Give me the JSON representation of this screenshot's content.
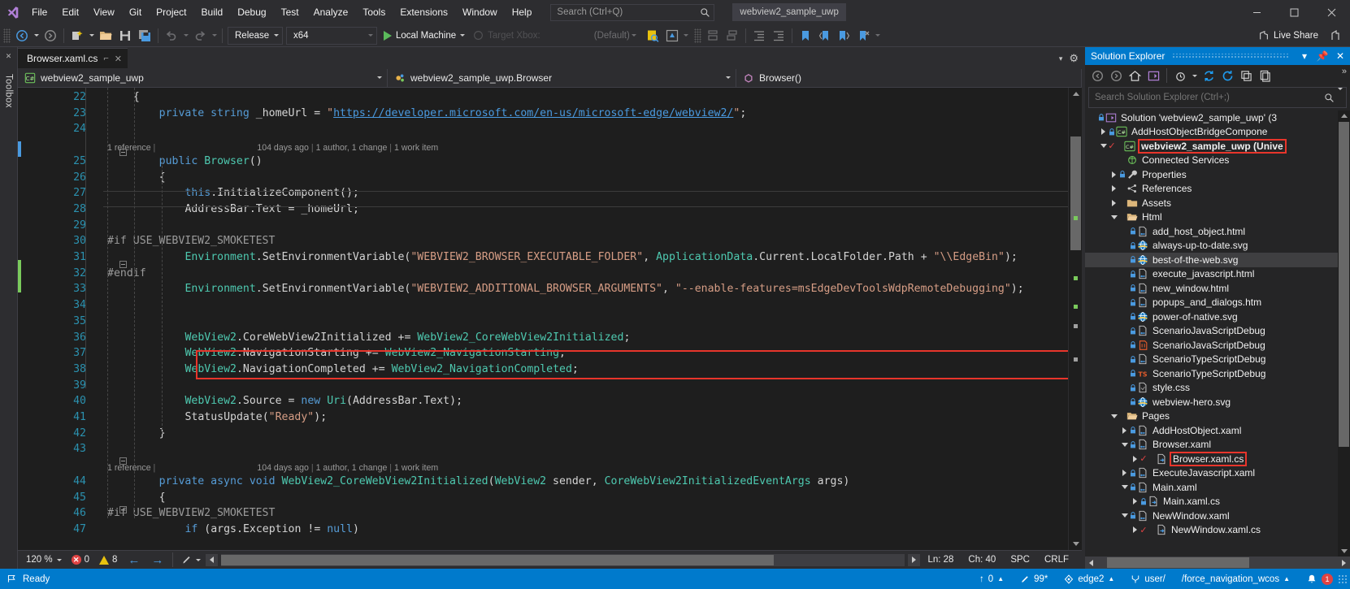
{
  "menubar": {
    "logo": "visual-studio-logo",
    "items": [
      "File",
      "Edit",
      "View",
      "Git",
      "Project",
      "Build",
      "Debug",
      "Test",
      "Analyze",
      "Tools",
      "Extensions",
      "Window",
      "Help"
    ],
    "search_placeholder": "Search (Ctrl+Q)",
    "solution_chip": "webview2_sample_uwp",
    "window_controls": [
      "minimize",
      "maximize",
      "close"
    ]
  },
  "toolbar": {
    "configuration": "Release",
    "platform": "x64",
    "run_target": "Local Machine",
    "target_xbox": "Target Xbox:",
    "default_label": "(Default)",
    "live_share": "Live Share"
  },
  "toolbox": {
    "label": "Toolbox"
  },
  "editor": {
    "tab_title": "Browser.xaml.cs",
    "nav_project": "webview2_sample_uwp",
    "nav_class": "webview2_sample_uwp.Browser",
    "nav_member": "Browser()",
    "zoom": "120 %",
    "errors": "0",
    "warnings": "8",
    "line_pos": "Ln: 28",
    "char_pos": "Ch: 40",
    "indent_mode": "SPC",
    "line_ending": "CRLF",
    "codelens": {
      "references": "1 reference",
      "age": "104 days ago",
      "authors": "1 author, 1 change",
      "work_items": "1 work item"
    },
    "lines": [
      {
        "num": "22",
        "text": "    {"
      },
      {
        "num": "23",
        "text": "        private string _homeUrl = \"https://developer.microsoft.com/en-us/microsoft-edge/webview2/\";"
      },
      {
        "num": "24",
        "text": ""
      },
      {
        "num": "",
        "text": "CODELENS_1"
      },
      {
        "num": "25",
        "text": "        public Browser()"
      },
      {
        "num": "26",
        "text": "        {"
      },
      {
        "num": "27",
        "text": "            this.InitializeComponent();"
      },
      {
        "num": "28",
        "text": "            AddressBar.Text = _homeUrl;"
      },
      {
        "num": "29",
        "text": ""
      },
      {
        "num": "30",
        "text": "#if USE_WEBVIEW2_SMOKETEST"
      },
      {
        "num": "31",
        "text": "            Environment.SetEnvironmentVariable(\"WEBVIEW2_BROWSER_EXECUTABLE_FOLDER\", ApplicationData.Current.LocalFolder.Path + \"\\\\EdgeBin\");"
      },
      {
        "num": "32",
        "text": "#endif"
      },
      {
        "num": "33",
        "text": "            Environment.SetEnvironmentVariable(\"WEBVIEW2_ADDITIONAL_BROWSER_ARGUMENTS\", \"--enable-features=msEdgeDevToolsWdpRemoteDebugging\");"
      },
      {
        "num": "34",
        "text": ""
      },
      {
        "num": "35",
        "text": ""
      },
      {
        "num": "36",
        "text": "            WebView2.CoreWebView2Initialized += WebView2_CoreWebView2Initialized;"
      },
      {
        "num": "37",
        "text": "            WebView2.NavigationStarting += WebView2_NavigationStarting;"
      },
      {
        "num": "38",
        "text": "            WebView2.NavigationCompleted += WebView2_NavigationCompleted;"
      },
      {
        "num": "39",
        "text": ""
      },
      {
        "num": "40",
        "text": "            WebView2.Source = new Uri(AddressBar.Text);"
      },
      {
        "num": "41",
        "text": "            StatusUpdate(\"Ready\");"
      },
      {
        "num": "42",
        "text": "        }"
      },
      {
        "num": "43",
        "text": ""
      },
      {
        "num": "",
        "text": "CODELENS_2"
      },
      {
        "num": "44",
        "text": "        private async void WebView2_CoreWebView2Initialized(WebView2 sender, CoreWebView2InitializedEventArgs args)"
      },
      {
        "num": "45",
        "text": "        {"
      },
      {
        "num": "46",
        "text": "#if USE_WEBVIEW2_SMOKETEST"
      },
      {
        "num": "47",
        "text": "            if (args.Exception != null)"
      }
    ]
  },
  "solution_explorer": {
    "title": "Solution Explorer",
    "search_placeholder": "Search Solution Explorer (Ctrl+;)",
    "toolbar_icons": [
      "back-icon",
      "forward-icon",
      "home-icon",
      "pending-changes-icon",
      "show-all-files-icon",
      "refresh-icon",
      "sync-icon",
      "collapse-all-icon",
      "properties-icon"
    ],
    "tree": [
      {
        "depth": 0,
        "twist": "none",
        "icon": "solution-icon",
        "lock": true,
        "label": "Solution 'webview2_sample_uwp' (3",
        "selected": false,
        "highlight": false,
        "check": false
      },
      {
        "depth": 1,
        "twist": "right",
        "icon": "csharp-project-icon",
        "lock": true,
        "label": "AddHostObjectBridgeCompone",
        "selected": false,
        "highlight": false,
        "check": false
      },
      {
        "depth": 1,
        "twist": "down",
        "icon": "csharp-project-icon",
        "lock": false,
        "label": "webview2_sample_uwp (Unive",
        "selected": false,
        "highlight": true,
        "check": true,
        "bold": true
      },
      {
        "depth": 2,
        "twist": "none",
        "icon": "connected-services-icon",
        "lock": false,
        "label": "Connected Services",
        "selected": false,
        "highlight": false,
        "check": false
      },
      {
        "depth": 2,
        "twist": "right",
        "icon": "properties-wrench-icon",
        "lock": true,
        "label": "Properties",
        "selected": false,
        "highlight": false,
        "check": false
      },
      {
        "depth": 2,
        "twist": "right",
        "icon": "references-icon",
        "lock": false,
        "label": "References",
        "selected": false,
        "highlight": false,
        "check": false
      },
      {
        "depth": 2,
        "twist": "right",
        "icon": "folder-icon",
        "lock": false,
        "label": "Assets",
        "selected": false,
        "highlight": false,
        "check": false
      },
      {
        "depth": 2,
        "twist": "down",
        "icon": "folder-open-icon",
        "lock": false,
        "label": "Html",
        "selected": false,
        "highlight": false,
        "check": false
      },
      {
        "depth": 3,
        "twist": "none",
        "icon": "html-file-icon",
        "lock": true,
        "label": "add_host_object.html",
        "selected": false,
        "highlight": false,
        "check": false
      },
      {
        "depth": 3,
        "twist": "none",
        "icon": "browser-file-icon",
        "lock": true,
        "label": "always-up-to-date.svg",
        "selected": false,
        "highlight": false,
        "check": false
      },
      {
        "depth": 3,
        "twist": "none",
        "icon": "browser-file-icon",
        "lock": true,
        "label": "best-of-the-web.svg",
        "selected": true,
        "highlight": false,
        "check": false
      },
      {
        "depth": 3,
        "twist": "none",
        "icon": "html-file-icon",
        "lock": true,
        "label": "execute_javascript.html",
        "selected": false,
        "highlight": false,
        "check": false
      },
      {
        "depth": 3,
        "twist": "none",
        "icon": "html-file-icon",
        "lock": true,
        "label": "new_window.html",
        "selected": false,
        "highlight": false,
        "check": false
      },
      {
        "depth": 3,
        "twist": "none",
        "icon": "html-file-icon",
        "lock": true,
        "label": "popups_and_dialogs.htm",
        "selected": false,
        "highlight": false,
        "check": false
      },
      {
        "depth": 3,
        "twist": "none",
        "icon": "browser-file-icon",
        "lock": true,
        "label": "power-of-native.svg",
        "selected": false,
        "highlight": false,
        "check": false
      },
      {
        "depth": 3,
        "twist": "none",
        "icon": "html-file-icon",
        "lock": true,
        "label": "ScenarioJavaScriptDebug",
        "selected": false,
        "highlight": false,
        "check": false
      },
      {
        "depth": 3,
        "twist": "none",
        "icon": "js-file-icon",
        "lock": true,
        "label": "ScenarioJavaScriptDebug",
        "selected": false,
        "highlight": false,
        "check": false
      },
      {
        "depth": 3,
        "twist": "none",
        "icon": "html-file-icon",
        "lock": true,
        "label": "ScenarioTypeScriptDebug",
        "selected": false,
        "highlight": false,
        "check": false
      },
      {
        "depth": 3,
        "twist": "none",
        "icon": "ts-file-icon",
        "lock": true,
        "label": "ScenarioTypeScriptDebug",
        "selected": false,
        "highlight": false,
        "check": false
      },
      {
        "depth": 3,
        "twist": "none",
        "icon": "css-file-icon",
        "lock": true,
        "label": "style.css",
        "selected": false,
        "highlight": false,
        "check": false
      },
      {
        "depth": 3,
        "twist": "none",
        "icon": "browser-file-icon",
        "lock": true,
        "label": "webview-hero.svg",
        "selected": false,
        "highlight": false,
        "check": false
      },
      {
        "depth": 2,
        "twist": "down",
        "icon": "folder-open-icon",
        "lock": false,
        "label": "Pages",
        "selected": false,
        "highlight": false,
        "check": false
      },
      {
        "depth": 3,
        "twist": "right",
        "icon": "xaml-file-icon",
        "lock": true,
        "label": "AddHostObject.xaml",
        "selected": false,
        "highlight": false,
        "check": false
      },
      {
        "depth": 3,
        "twist": "down",
        "icon": "xaml-file-icon",
        "lock": true,
        "label": "Browser.xaml",
        "selected": false,
        "highlight": false,
        "check": false
      },
      {
        "depth": 4,
        "twist": "right",
        "icon": "csharp-code-icon",
        "lock": false,
        "label": "Browser.xaml.cs",
        "selected": false,
        "highlight": true,
        "check": true
      },
      {
        "depth": 3,
        "twist": "right",
        "icon": "xaml-file-icon",
        "lock": true,
        "label": "ExecuteJavascript.xaml",
        "selected": false,
        "highlight": false,
        "check": false
      },
      {
        "depth": 3,
        "twist": "down",
        "icon": "xaml-file-icon",
        "lock": true,
        "label": "Main.xaml",
        "selected": false,
        "highlight": false,
        "check": false
      },
      {
        "depth": 4,
        "twist": "right",
        "icon": "csharp-code-icon",
        "lock": true,
        "label": "Main.xaml.cs",
        "selected": false,
        "highlight": false,
        "check": false
      },
      {
        "depth": 3,
        "twist": "down",
        "icon": "xaml-file-icon",
        "lock": true,
        "label": "NewWindow.xaml",
        "selected": false,
        "highlight": false,
        "check": false
      },
      {
        "depth": 4,
        "twist": "right",
        "icon": "csharp-code-icon",
        "lock": false,
        "label": "NewWindow.xaml.cs",
        "selected": false,
        "highlight": false,
        "check": true
      }
    ]
  },
  "statusbar": {
    "ready": "Ready",
    "unpushed": "0",
    "unstaged": "99*",
    "repo": "edge2",
    "user": "user/",
    "branch": "/force_navigation_wcos",
    "notifications": "1"
  },
  "colors": {
    "accent": "#007acc",
    "chrome": "#2d2d30",
    "editor_bg": "#1e1e1e",
    "panel_bg": "#252526",
    "highlight_red": "#e8352b",
    "error_red": "#e04343",
    "warn_yellow": "#e8c20e",
    "link_blue": "#4a9ae0",
    "keyword_blue": "#569cd6",
    "type_teal": "#4ec9b0",
    "string_brown": "#d69d85"
  }
}
